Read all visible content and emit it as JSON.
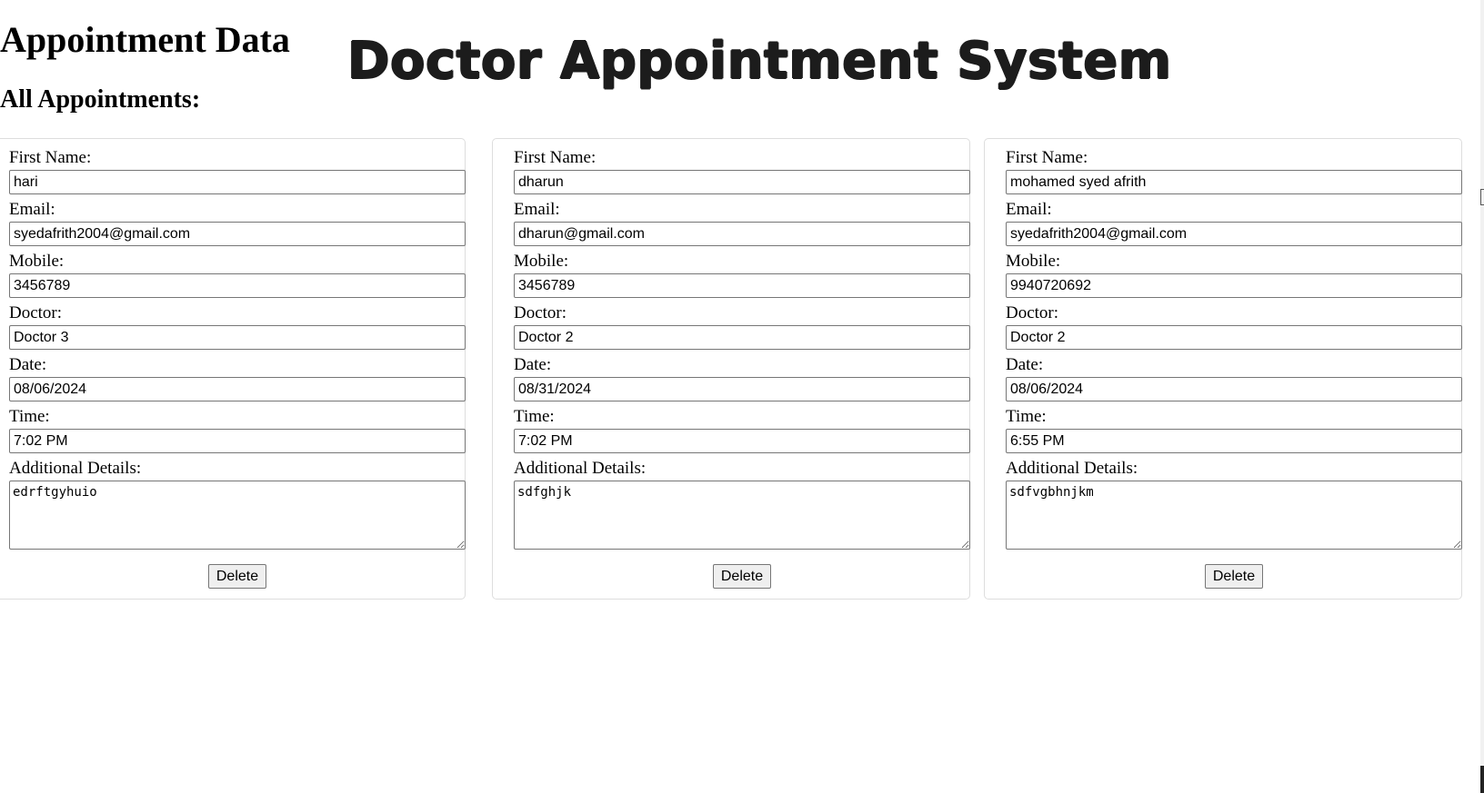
{
  "page": {
    "heading": "Appointment Data",
    "system_title": "Doctor Appointment System",
    "section_heading": "All Appointments:"
  },
  "labels": {
    "first_name": "First Name:",
    "email": "Email:",
    "mobile": "Mobile:",
    "doctor": "Doctor:",
    "date": "Date:",
    "time": "Time:",
    "additional_details": "Additional Details:",
    "delete": "Delete"
  },
  "appointments": [
    {
      "first_name": "hari",
      "email": "syedafrith2004@gmail.com",
      "mobile": "3456789",
      "doctor": "Doctor 3",
      "date": "08/06/2024",
      "time": "7:02 PM",
      "details": "edrftgyhuio"
    },
    {
      "first_name": "dharun",
      "email": "dharun@gmail.com",
      "mobile": "3456789",
      "doctor": "Doctor 2",
      "date": "08/31/2024",
      "time": "7:02 PM",
      "details": "sdfghjk"
    },
    {
      "first_name": "mohamed syed afrith",
      "email": "syedafrith2004@gmail.com",
      "mobile": "9940720692",
      "doctor": "Doctor 2",
      "date": "08/06/2024",
      "time": "6:55 PM",
      "details": "sdfvgbhnjkm"
    }
  ]
}
